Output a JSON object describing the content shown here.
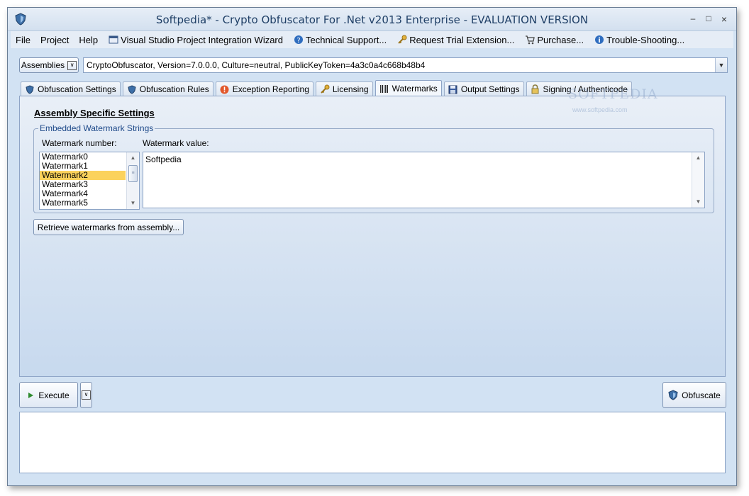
{
  "window": {
    "title": "Softpedia* - Crypto Obfuscator For .Net v2013 Enterprise - EVALUATION VERSION",
    "controls": {
      "minimize": "–",
      "maximize": "□",
      "close": "×"
    }
  },
  "menu": {
    "items": [
      {
        "label": "File",
        "icon": null
      },
      {
        "label": "Project",
        "icon": null
      },
      {
        "label": "Help",
        "icon": null
      },
      {
        "label": "Visual Studio Project Integration Wizard",
        "icon": "vs-integration-icon"
      },
      {
        "label": "Technical Support...",
        "icon": "help-icon"
      },
      {
        "label": "Request Trial Extension...",
        "icon": "key-icon"
      },
      {
        "label": "Purchase...",
        "icon": "cart-icon"
      },
      {
        "label": "Trouble-Shooting...",
        "icon": "info-icon"
      }
    ]
  },
  "assemblies": {
    "button_label": "Assemblies",
    "selected_value": "CryptoObfuscator, Version=7.0.0.0, Culture=neutral, PublicKeyToken=4a3c0a4c668b48b4"
  },
  "tabs": [
    {
      "label": "Obfuscation Settings",
      "icon": "shield-icon",
      "active": false
    },
    {
      "label": "Obfuscation Rules",
      "icon": "shield-icon",
      "active": false
    },
    {
      "label": "Exception Reporting",
      "icon": "alert-icon",
      "active": false
    },
    {
      "label": "Licensing",
      "icon": "key-icon",
      "active": false
    },
    {
      "label": "Watermarks",
      "icon": "barcode-icon",
      "active": true
    },
    {
      "label": "Output Settings",
      "icon": "save-icon",
      "active": false
    },
    {
      "label": "Signing / Authenticode",
      "icon": "lock-icon",
      "active": false
    }
  ],
  "watermarks": {
    "section_title": "Assembly Specific Settings",
    "group_title": "Embedded Watermark Strings",
    "number_label": "Watermark number:",
    "value_label": "Watermark value:",
    "list_items": [
      "Watermark0",
      "Watermark1",
      "Watermark2",
      "Watermark3",
      "Watermark4",
      "Watermark5"
    ],
    "selected_index": 2,
    "value": "Softpedia",
    "retrieve_button": "Retrieve watermarks from assembly..."
  },
  "bottom": {
    "execute_label": "Execute",
    "obfuscate_label": "Obfuscate"
  },
  "overlay": {
    "brand": "SOFTPEDIA",
    "url": "www.softpedia.com"
  },
  "colors": {
    "accent": "#1f4b8a",
    "selection": "#fbd25c",
    "panel": "#d2e2f3"
  }
}
